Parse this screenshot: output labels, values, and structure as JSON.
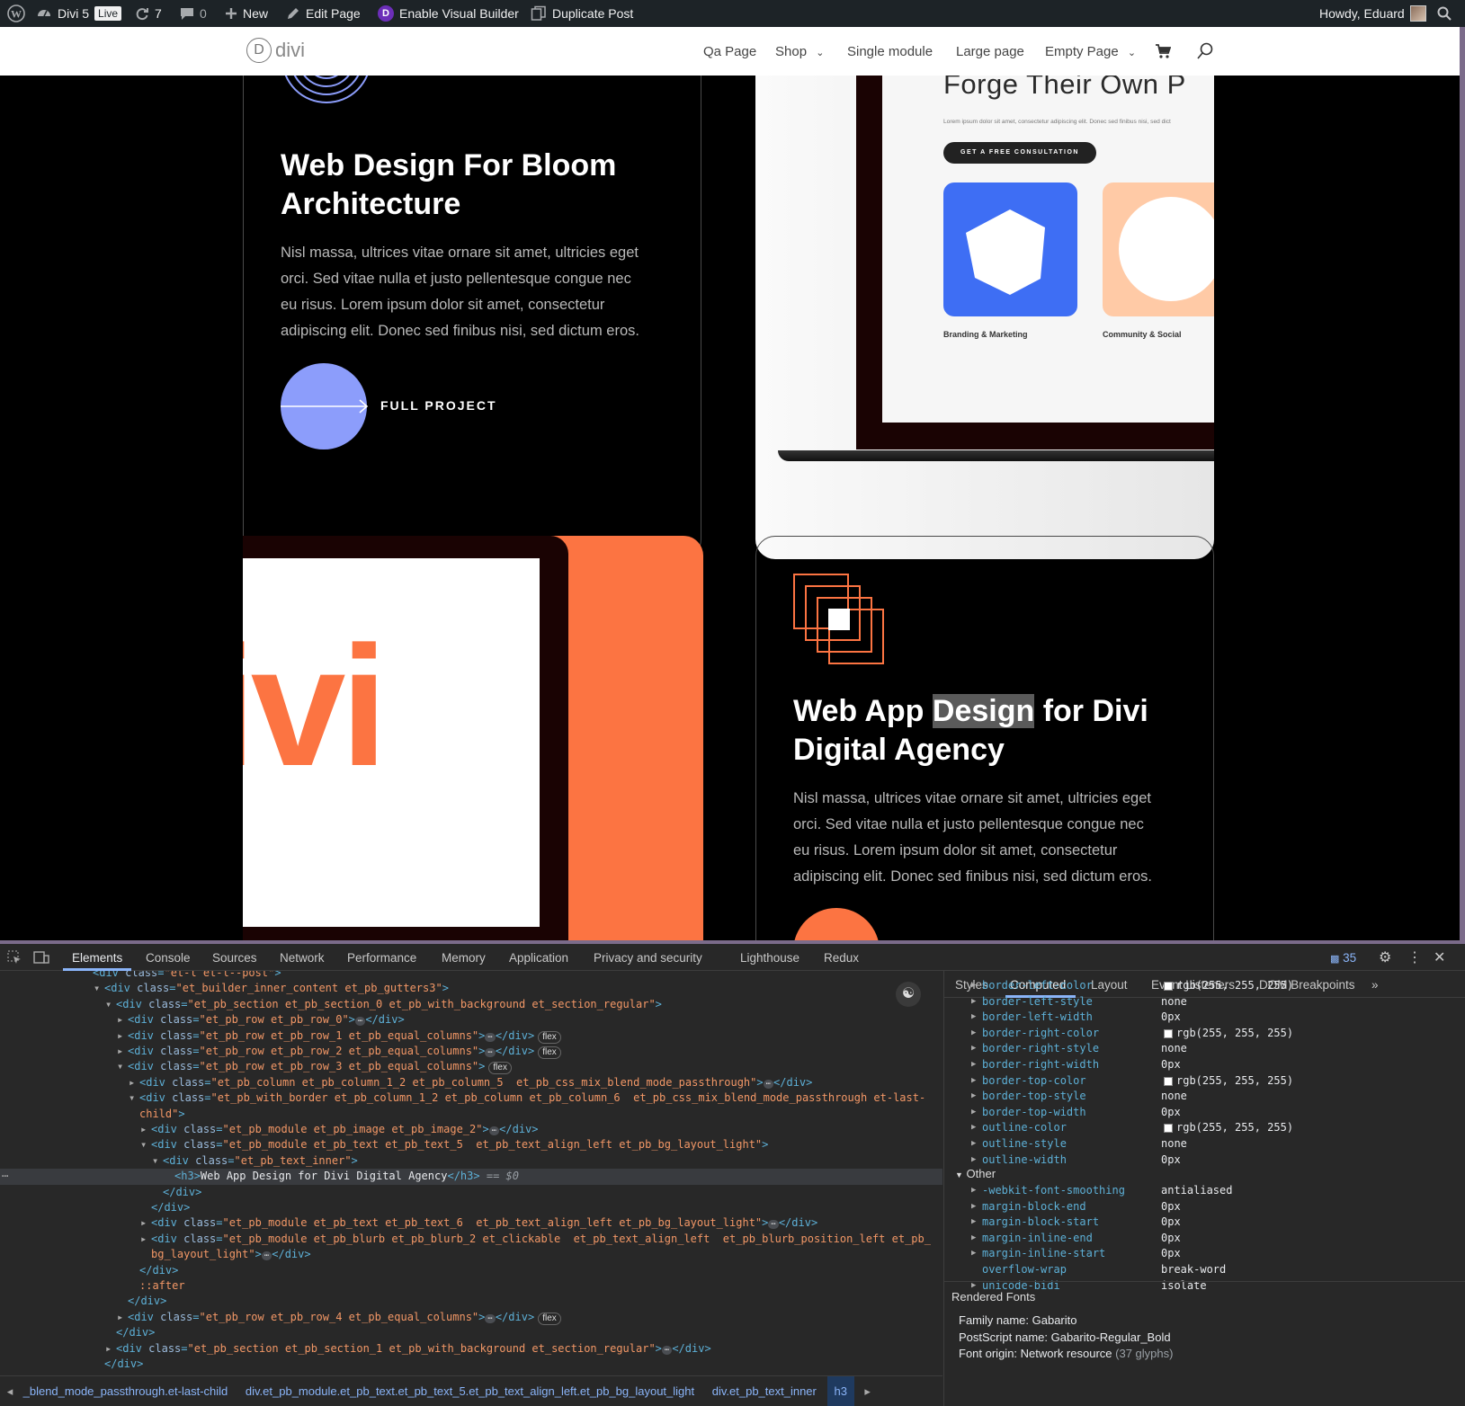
{
  "admin_bar": {
    "site_name": "Divi 5",
    "live_badge": "Live",
    "updates_count": "7",
    "comments_count": "0",
    "new_label": "New",
    "edit_page_label": "Edit Page",
    "visual_builder_icon_letter": "D",
    "visual_builder_label": "Enable Visual Builder",
    "duplicate_label": "Duplicate Post",
    "greeting": "Howdy, Eduard"
  },
  "site_header": {
    "logo_letter": "D",
    "logo_text": "divi",
    "nav_items": [
      "Qa Page",
      "Shop",
      "Single module",
      "Large page",
      "Empty Page"
    ]
  },
  "card1": {
    "title_line1": "Web Design For Bloom",
    "title_line2": "Architecture",
    "para_lines": [
      "Nisl massa, ultrices vitae ornare sit amet, ultricies eget",
      "orci. Sed vitae nulla et justo pellentesque congue nec",
      "eu risus. Lorem ipsum dolor sit amet, consectetur",
      "adipiscing elit. Donec sed finibus nisi, sed dictum eros."
    ],
    "cta_label": "FULL PROJECT"
  },
  "laptop_mock": {
    "heading": "Forge Their Own P",
    "small_text": "Lorem ipsum dolor sit amet, consectetur adipiscing elit. Donec sed finibus nisi, sed dict",
    "button_label": "GET A FREE CONSULTATION",
    "tile1_label": "Branding & Marketing",
    "tile2_label": "Community & Social"
  },
  "tablet_mock": {
    "brand_text": "ivi"
  },
  "card2": {
    "title_line1_a": "Web App ",
    "title_line1_highlight": "Design",
    "title_line1_b": " for Divi",
    "title_line2": "Digital Agency",
    "para_lines": [
      "Nisl massa, ultrices vitae ornare sit amet, ultricies eget",
      "orci. Sed vitae nulla et justo pellentesque congue nec",
      "eu risus. Lorem ipsum dolor sit amet, consectetur",
      "adipiscing elit. Donec sed finibus nisi, sed dictum eros."
    ]
  },
  "devtools": {
    "tabs": [
      "Elements",
      "Console",
      "Sources",
      "Network",
      "Performance",
      "Memory",
      "Application",
      "Privacy and security",
      "Lighthouse",
      "Redux"
    ],
    "issues_count": "35",
    "side_tabs": [
      "Styles",
      "Computed",
      "Layout",
      "Event Listeners",
      "DOM Breakpoints"
    ],
    "computed_props": [
      {
        "name": "border-left-color",
        "value": "rgb(255, 255, 255)",
        "swatch": true
      },
      {
        "name": "border-left-style",
        "value": "none",
        "swatch": false
      },
      {
        "name": "border-left-width",
        "value": "0px",
        "swatch": false
      },
      {
        "name": "border-right-color",
        "value": "rgb(255, 255, 255)",
        "swatch": true
      },
      {
        "name": "border-right-style",
        "value": "none",
        "swatch": false
      },
      {
        "name": "border-right-width",
        "value": "0px",
        "swatch": false
      },
      {
        "name": "border-top-color",
        "value": "rgb(255, 255, 255)",
        "swatch": true
      },
      {
        "name": "border-top-style",
        "value": "none",
        "swatch": false
      },
      {
        "name": "border-top-width",
        "value": "0px",
        "swatch": false
      },
      {
        "name": "outline-color",
        "value": "rgb(255, 255, 255)",
        "swatch": true
      },
      {
        "name": "outline-style",
        "value": "none",
        "swatch": false
      },
      {
        "name": "outline-width",
        "value": "0px",
        "swatch": false
      }
    ],
    "other_group_label": "Other",
    "other_props": [
      {
        "name": "-webkit-font-smoothing",
        "value": "antialiased",
        "arrow": true
      },
      {
        "name": "margin-block-end",
        "value": "0px",
        "arrow": true
      },
      {
        "name": "margin-block-start",
        "value": "0px",
        "arrow": true
      },
      {
        "name": "margin-inline-end",
        "value": "0px",
        "arrow": true
      },
      {
        "name": "margin-inline-start",
        "value": "0px",
        "arrow": true
      },
      {
        "name": "overflow-wrap",
        "value": "break-word",
        "arrow": false
      },
      {
        "name": "unicode-bidi",
        "value": "isolate",
        "arrow": true
      }
    ],
    "rendered_fonts_label": "Rendered Fonts",
    "font_family": "Family name: Gabarito",
    "font_postscript": "PostScript name: Gabarito-Regular_Bold",
    "font_origin": "Font origin: Network resource",
    "font_glyphs": "(37 glyphs)",
    "breadcrumbs": [
      "_blend_mode_passthrough.et-last-child",
      "div.et_pb_module.et_pb_text.et_pb_text_5.et_pb_text_align_left.et_pb_bg_layout_light",
      "div.et_pb_text_inner",
      "h3"
    ],
    "dom_lines": [
      {
        "indent": 7,
        "arrow": "",
        "html": "<div class=\"et-l et-l--post\">",
        "badge": "",
        "ellipsis": false
      },
      {
        "indent": 8,
        "arrow": "▾",
        "html": "<div class=\"et_builder_inner_content et_pb_gutters3\">",
        "badge": "",
        "ellipsis": false
      },
      {
        "indent": 9,
        "arrow": "▾",
        "html": "<div class=\"et_pb_section et_pb_section_0 et_pb_with_background et_section_regular\">",
        "badge": "",
        "ellipsis": false
      },
      {
        "indent": 10,
        "arrow": "▸",
        "html": "<div class=\"et_pb_row et_pb_row_0\">",
        "badge": "",
        "ellipsis": true
      },
      {
        "indent": 10,
        "arrow": "▸",
        "html": "<div class=\"et_pb_row et_pb_row_1 et_pb_equal_columns\">",
        "badge": "flex",
        "ellipsis": true
      },
      {
        "indent": 10,
        "arrow": "▸",
        "html": "<div class=\"et_pb_row et_pb_row_2 et_pb_equal_columns\">",
        "badge": "flex",
        "ellipsis": true
      },
      {
        "indent": 10,
        "arrow": "▾",
        "html": "<div class=\"et_pb_row et_pb_row_3 et_pb_equal_columns\">",
        "badge": "flex",
        "ellipsis": false
      },
      {
        "indent": 11,
        "arrow": "▸",
        "html": "<div class=\"et_pb_column et_pb_column_1_2 et_pb_column_5  et_pb_css_mix_blend_mode_passthrough\">",
        "badge": "",
        "ellipsis": true
      },
      {
        "indent": 11,
        "arrow": "▾",
        "html": "<div class=\"et_pb_with_border et_pb_column_1_2 et_pb_column et_pb_column_6  et_pb_css_mix_blend_mode_passthrough et-last-",
        "badge": "",
        "ellipsis": false
      },
      {
        "indent": 11,
        "arrow": "",
        "html": "child\">",
        "badge": "",
        "ellipsis": false
      },
      {
        "indent": 12,
        "arrow": "▸",
        "html": "<div class=\"et_pb_module et_pb_image et_pb_image_2\">",
        "badge": "",
        "ellipsis": true
      },
      {
        "indent": 12,
        "arrow": "▾",
        "html": "<div class=\"et_pb_module et_pb_text et_pb_text_5  et_pb_text_align_left et_pb_bg_layout_light\">",
        "badge": "",
        "ellipsis": false
      },
      {
        "indent": 13,
        "arrow": "▾",
        "html": "<div class=\"et_pb_text_inner\">",
        "badge": "",
        "ellipsis": false
      },
      {
        "indent": 14,
        "arrow": "",
        "html": "<h3>Web App Design for Divi Digital Agency</h3>",
        "badge": "",
        "ellipsis": false,
        "selected": true
      },
      {
        "indent": 13,
        "arrow": "",
        "html": "</div>",
        "badge": "",
        "ellipsis": false
      },
      {
        "indent": 12,
        "arrow": "",
        "html": "</div>",
        "badge": "",
        "ellipsis": false
      },
      {
        "indent": 12,
        "arrow": "▸",
        "html": "<div class=\"et_pb_module et_pb_text et_pb_text_6  et_pb_text_align_left et_pb_bg_layout_light\">",
        "badge": "",
        "ellipsis": true
      },
      {
        "indent": 12,
        "arrow": "▸",
        "html": "<div class=\"et_pb_module et_pb_blurb et_pb_blurb_2 et_clickable  et_pb_text_align_left  et_pb_blurb_position_left et_pb_",
        "badge": "",
        "ellipsis": false
      },
      {
        "indent": 12,
        "arrow": "",
        "html": "bg_layout_light\">",
        "badge": "",
        "ellipsis": true
      },
      {
        "indent": 11,
        "arrow": "",
        "html": "</div>",
        "badge": "",
        "ellipsis": false
      },
      {
        "indent": 11,
        "arrow": "",
        "html": "::after",
        "badge": "",
        "ellipsis": false
      },
      {
        "indent": 10,
        "arrow": "",
        "html": "</div>",
        "badge": "",
        "ellipsis": false
      },
      {
        "indent": 10,
        "arrow": "▸",
        "html": "<div class=\"et_pb_row et_pb_row_4 et_pb_equal_columns\">",
        "badge": "flex",
        "ellipsis": true
      },
      {
        "indent": 9,
        "arrow": "",
        "html": "</div>",
        "badge": "",
        "ellipsis": false
      },
      {
        "indent": 9,
        "arrow": "▸",
        "html": "<div class=\"et_pb_section et_pb_section_1 et_pb_with_background et_section_regular\">",
        "badge": "",
        "ellipsis": true
      },
      {
        "indent": 8,
        "arrow": "",
        "html": "</div>",
        "badge": "",
        "ellipsis": false
      }
    ],
    "selected_marker": "== $0"
  },
  "colors": {
    "accent_purple": "#8c9dfb",
    "accent_orange": "#fc7442",
    "mock_blue": "#3e6ef4",
    "mock_peach": "#ffcaa6"
  }
}
